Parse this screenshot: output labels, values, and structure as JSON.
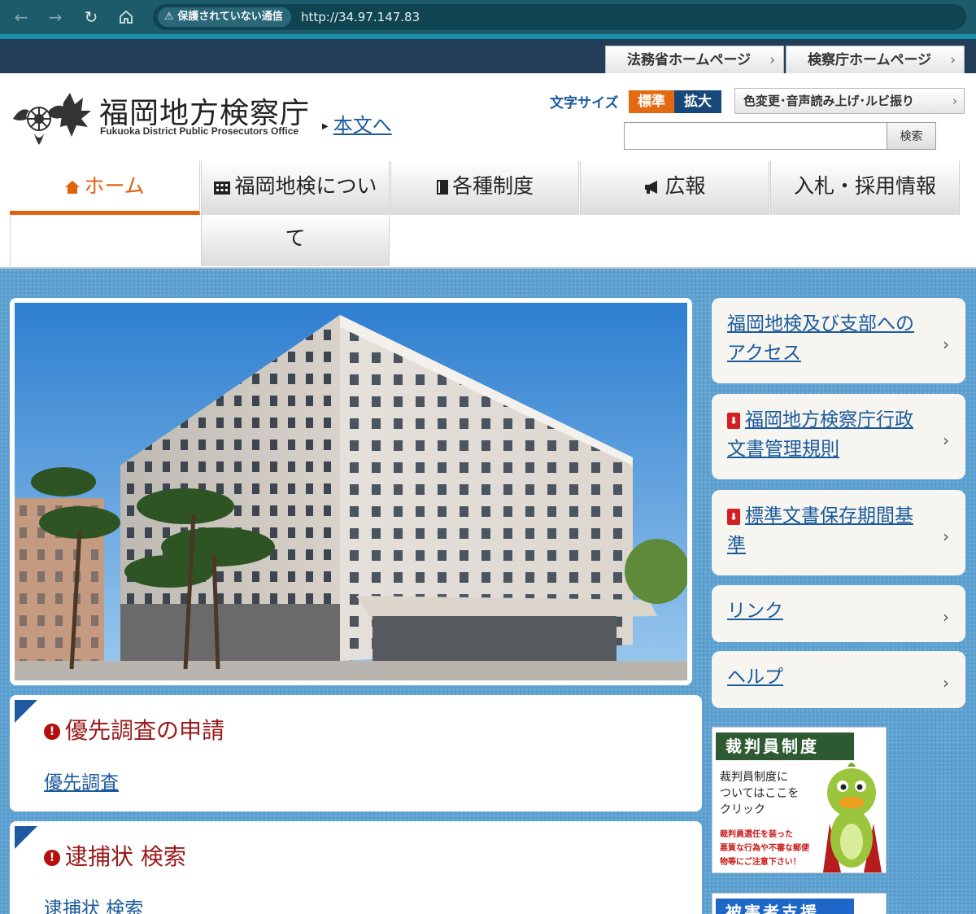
{
  "browser": {
    "back_icon": "arrow-left-icon",
    "forward_icon": "arrow-right-icon",
    "reload_icon": "reload-icon",
    "home_icon": "home-icon",
    "security_label": "保護されていない通信",
    "url": "http://34.97.147.83"
  },
  "top_links": {
    "moj": "法務省ホームページ",
    "kensatsu": "検察庁ホームページ"
  },
  "header": {
    "title": "福岡地方検察庁",
    "subtitle": "Fukuoka District Public Prosecutors Office",
    "skip_link": "本文へ",
    "font_size_label": "文字サイズ",
    "font_size_standard": "標準",
    "font_size_large": "拡大",
    "accessibility": "色変更･音声読み上げ･ルビ振り",
    "search_placeholder": "",
    "search_button": "検索"
  },
  "gnav": {
    "home": "ホーム",
    "about_line1": "福岡地検につい",
    "about_line2": "て",
    "systems": "各種制度",
    "pr": "広報",
    "bids": "入札・採用情報"
  },
  "cards": [
    {
      "title": "優先調査の申請",
      "link": "優先調査"
    },
    {
      "title": "逮捕状 検索",
      "link": "逮捕状 検索"
    }
  ],
  "side_links": [
    {
      "line1": "福岡地検及び支部への",
      "line2": "アクセス"
    },
    {
      "line1": "福岡地方検察庁行政",
      "line2": "文書管理規則"
    },
    {
      "line1": "標準文書保存期間基",
      "line2": "準"
    },
    {
      "line1": "リンク"
    },
    {
      "line1": "ヘルプ"
    }
  ],
  "banner": {
    "heading": "裁判員制度",
    "line1": "裁判員制度に",
    "line2": "ついてはここを",
    "line3": "クリック",
    "warn1": "裁判員選任を装った",
    "warn2": "悪質な行為や不審な郵便",
    "warn3": "物等にご注意下さい！"
  },
  "banner2": {
    "heading": "被害者支援"
  },
  "colors": {
    "accent_orange": "#e0620d",
    "navy": "#17487a",
    "link_blue": "#1a5a9c",
    "title_red": "#9b1a1a",
    "background_blue": "#5b9fcf"
  }
}
